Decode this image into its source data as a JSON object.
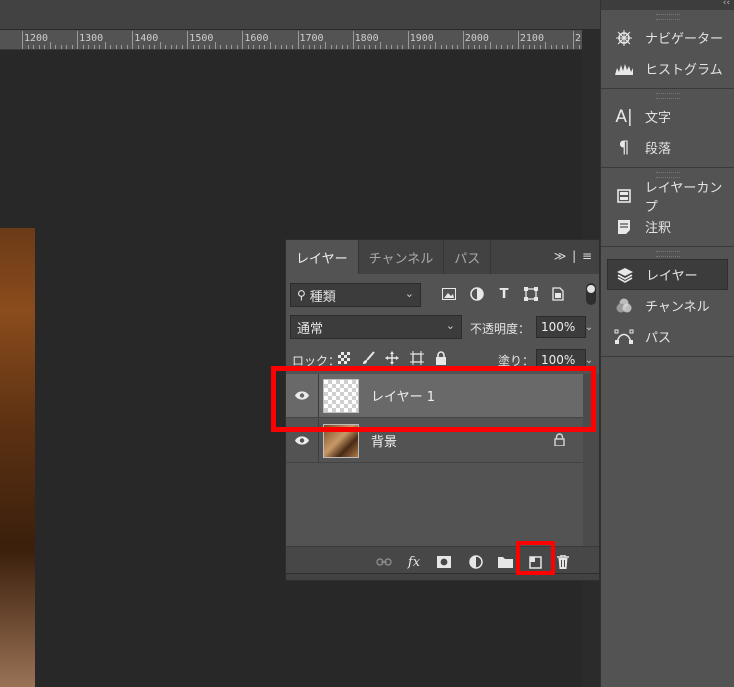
{
  "ruler": {
    "labels": [
      "1200",
      "1300",
      "1400",
      "1500",
      "1600",
      "1700",
      "1800",
      "1900",
      "2000",
      "2100",
      "2"
    ]
  },
  "dock": {
    "collapse_glyph": "‹‹",
    "groups": [
      {
        "items": [
          {
            "label": "ナビゲーター",
            "icon": "navigator-icon"
          },
          {
            "label": "ヒストグラム",
            "icon": "histogram-icon"
          }
        ]
      },
      {
        "items": [
          {
            "label": "文字",
            "icon": "character-icon"
          },
          {
            "label": "段落",
            "icon": "paragraph-icon"
          }
        ]
      },
      {
        "items": [
          {
            "label": "レイヤーカンプ",
            "icon": "layer-comps-icon"
          },
          {
            "label": "注釈",
            "icon": "notes-icon"
          }
        ]
      },
      {
        "items": [
          {
            "label": "レイヤー",
            "icon": "layers-icon",
            "active": true
          },
          {
            "label": "チャンネル",
            "icon": "channels-icon"
          },
          {
            "label": "パス",
            "icon": "paths-icon"
          }
        ]
      }
    ]
  },
  "layers_panel": {
    "tabs": [
      "レイヤー",
      "チャンネル",
      "パス"
    ],
    "active_tab": "レイヤー",
    "menu_glyph": "≫ | ≡",
    "filter": {
      "value": "種類",
      "icon": "search-icon"
    },
    "blend_mode": "通常",
    "opacity_label": "不透明度：",
    "opacity_value": "100%",
    "lock_label": "ロック：",
    "fill_label": "塗り：",
    "fill_value": "100%",
    "layers": [
      {
        "name": "レイヤー 1",
        "selected": true,
        "visible": true,
        "type": "transparent"
      },
      {
        "name": "背景",
        "selected": false,
        "visible": true,
        "type": "image",
        "locked": true
      }
    ],
    "footer_buttons": [
      {
        "name": "link-layers",
        "glyph": "⊝"
      },
      {
        "name": "layer-style",
        "glyph": "fx"
      },
      {
        "name": "add-mask",
        "glyph": "◘"
      },
      {
        "name": "adjustment-layer",
        "glyph": "◐"
      },
      {
        "name": "new-group",
        "glyph": "▬"
      },
      {
        "name": "new-layer",
        "glyph": "⧉"
      },
      {
        "name": "delete-layer",
        "glyph": "🗑"
      }
    ]
  },
  "highlight_color": "#ff0000"
}
